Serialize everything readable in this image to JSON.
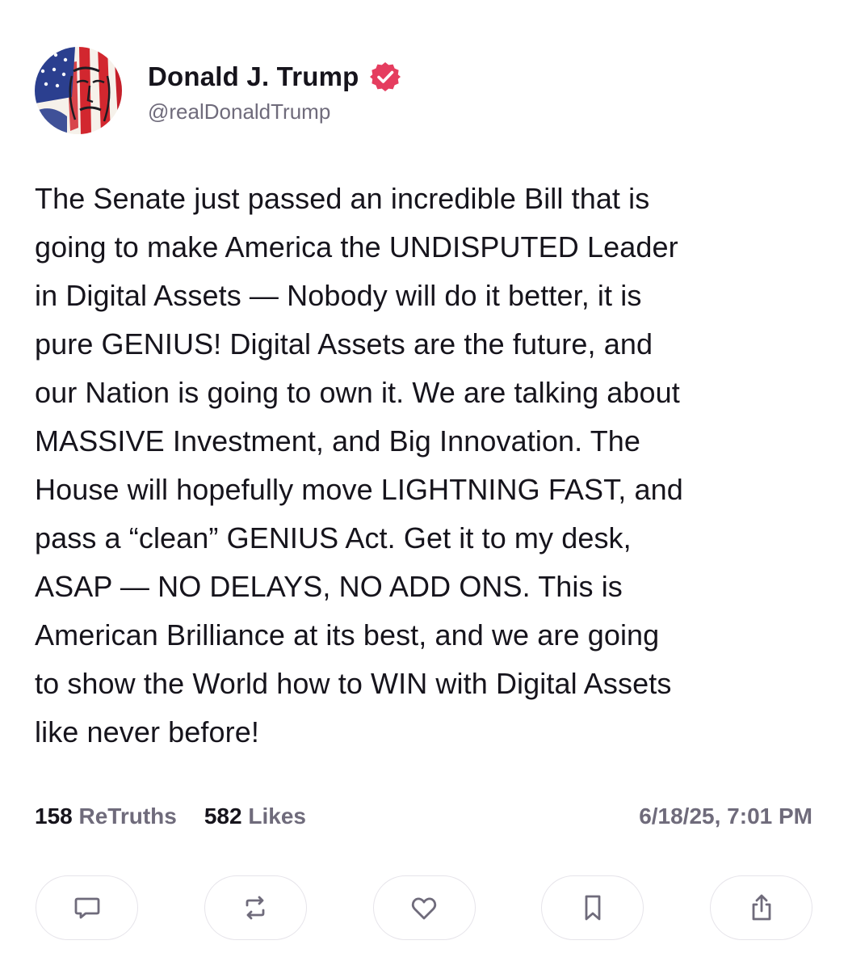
{
  "author": {
    "display_name": "Donald J. Trump",
    "handle": "@realDonaldTrump",
    "verified_icon": "verified-badge-icon",
    "verified_color": "#e53d5f",
    "avatar": "avatar-flag-portrait"
  },
  "post": {
    "text": "The Senate just passed an incredible Bill that is\ngoing to make America the UNDISPUTED Leader\nin Digital Assets — Nobody will do it better, it is\npure GENIUS! Digital Assets are the future, and\nour Nation is going to own it. We are talking about\nMASSIVE Investment, and Big Innovation. The\nHouse will hopefully move LIGHTNING FAST, and\npass a “clean” GENIUS Act. Get it to my desk,\nASAP — NO DELAYS, NO ADD ONS. This is\nAmerican Brilliance at its best, and we are going\nto show the World how to WIN with Digital Assets\nlike never before!"
  },
  "stats": {
    "retruths_count": "158",
    "retruths_label": "ReTruths",
    "likes_count": "582",
    "likes_label": "Likes",
    "timestamp": "6/18/25, 7:01 PM"
  },
  "actions": [
    {
      "icon": "reply-icon"
    },
    {
      "icon": "retruth-icon"
    },
    {
      "icon": "like-heart-icon"
    },
    {
      "icon": "bookmark-icon"
    },
    {
      "icon": "share-icon"
    }
  ],
  "colors": {
    "text_primary": "#16141c",
    "text_secondary": "#6f6b7b",
    "button_border": "#e6e4ea",
    "icon_stroke": "#6f6b7b"
  }
}
